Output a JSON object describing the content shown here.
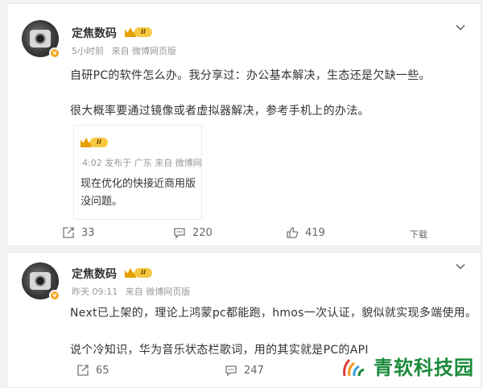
{
  "posts": [
    {
      "author": "定焦数码",
      "level_badge": "II",
      "verified_mark": "v",
      "time": "5小时前",
      "source": "来自 微博网页版",
      "lines": [
        "自研PC的软件怎么办。我分享过：办公基本解决，生态还是欠缺一些。",
        "很大概率要通过镜像或者虚拟器解决，参考手机上的办法。"
      ],
      "quote": {
        "level_badge": "II",
        "meta": "4:02  发布于 广东  来自 微博网",
        "lines": [
          "现在优化的快接近商用版",
          "没问题。"
        ]
      },
      "actions": {
        "share": "33",
        "comment": "220",
        "like": "419",
        "download": "下载"
      }
    },
    {
      "author": "定焦数码",
      "level_badge": "II",
      "verified_mark": "v",
      "time": "昨天 09:11",
      "source": "来自 微博网页版",
      "lines": [
        "Next已上架的，理论上鸿蒙pc都能跑，hmos一次认证，貌似就实现多端使用。",
        "说个冷知识，华为音乐状态栏歌词，用的其实就是PC的API"
      ],
      "actions": {
        "share": "65",
        "comment": "247"
      }
    }
  ],
  "watermark": {
    "text": "青软科技园"
  },
  "icons": [
    "avatar",
    "verified-icon",
    "level-crown-icon",
    "chevron-down-icon",
    "share-icon",
    "comment-icon",
    "like-icon"
  ],
  "colors": {
    "background": "#f2f2f2",
    "card": "#ffffff",
    "meta": "#999999",
    "level": "#f5c842",
    "watermark": "#1a8a3a"
  }
}
